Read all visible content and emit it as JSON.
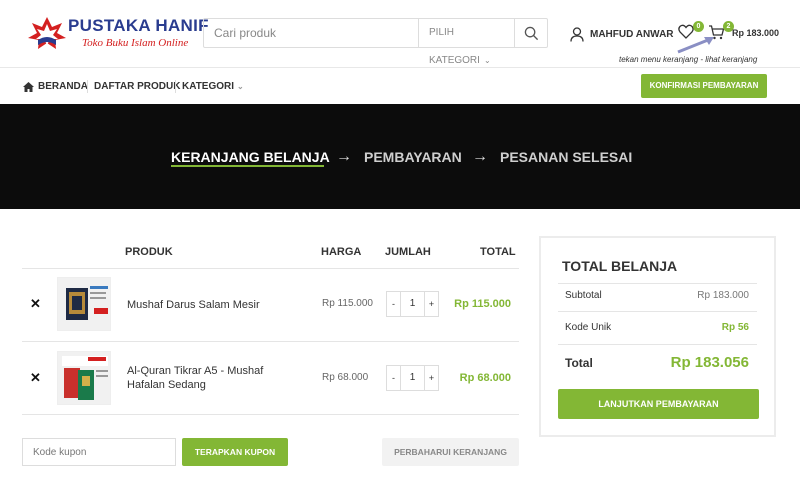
{
  "brand": {
    "name": "PUSTAKA HANIF",
    "tagline": "Toko Buku Islam Online",
    "colors": {
      "accent": "#83b735",
      "brand_blue": "#2a3c8f",
      "brand_red": "#d42020",
      "banner_bg": "#0c0c0c"
    }
  },
  "search": {
    "placeholder": "Cari produk",
    "category_label": "PILIH KATEGORI"
  },
  "header": {
    "user_name": "MAHFUD ANWAR",
    "wishlist_count": "0",
    "cart_count": "2",
    "cart_total": "Rp 183.000",
    "annotation": "tekan menu keranjang - lihat keranjang"
  },
  "nav": {
    "home": "BERANDA",
    "products": "DAFTAR PRODUK",
    "categories": "KATEGORI",
    "confirm_button": "KONFIRMASI PEMBAYARAN"
  },
  "steps": {
    "cart": "KERANJANG BELANJA",
    "payment": "PEMBAYARAN",
    "done": "PESANAN SELESAI"
  },
  "cart": {
    "headers": {
      "product": "PRODUK",
      "price": "HARGA",
      "qty": "JUMLAH",
      "total": "TOTAL"
    },
    "items": [
      {
        "name": "Mushaf Darus Salam Mesir",
        "price": "Rp 115.000",
        "qty": "1",
        "total": "Rp 115.000"
      },
      {
        "name": "Al-Quran Tikrar A5 - Mushaf Hafalan Sedang",
        "price": "Rp 68.000",
        "qty": "1",
        "total": "Rp 68.000"
      }
    ],
    "coupon_placeholder": "Kode kupon",
    "apply_button": "TERAPKAN KUPON",
    "update_button": "PERBAHARUI KERANJANG"
  },
  "totals": {
    "title": "TOTAL BELANJA",
    "subtotal_label": "Subtotal",
    "subtotal_value": "Rp 183.000",
    "unique_label": "Kode Unik",
    "unique_value": "Rp 56",
    "total_label": "Total",
    "total_value": "Rp 183.056",
    "checkout_button": "LANJUTKAN PEMBAYARAN"
  }
}
